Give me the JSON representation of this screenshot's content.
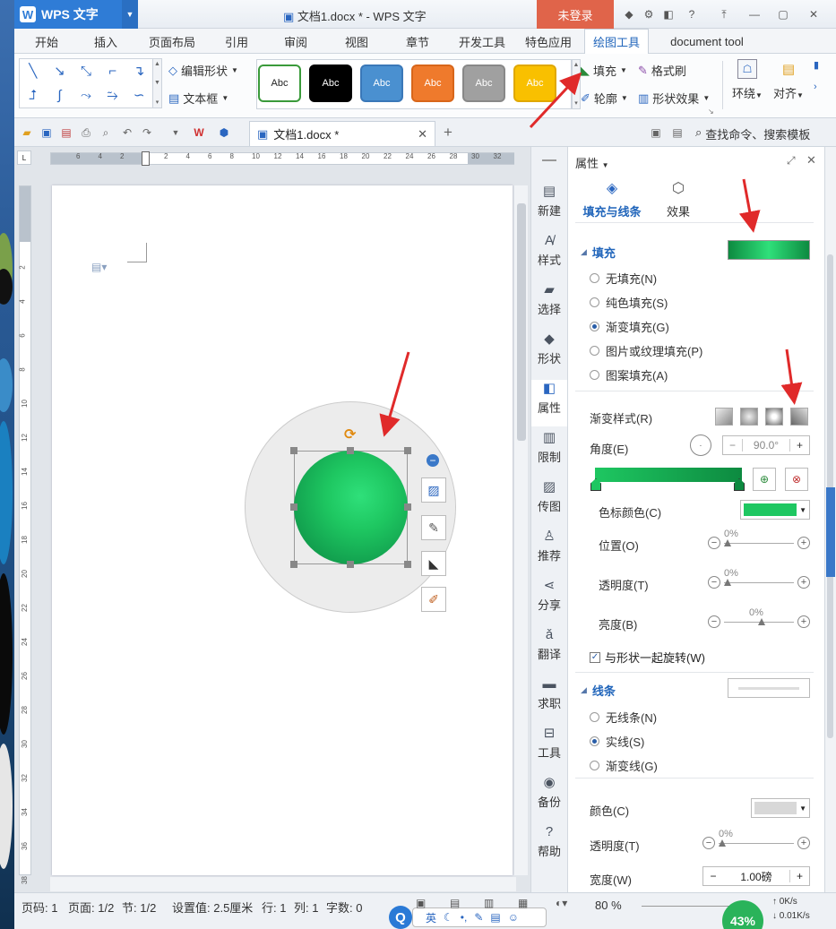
{
  "window": {
    "app_button": "WPS 文字",
    "title": "文档1.docx * - WPS 文字",
    "login_button": "未登录"
  },
  "menu_tabs": [
    {
      "label": "开始"
    },
    {
      "label": "插入"
    },
    {
      "label": "页面布局"
    },
    {
      "label": "引用"
    },
    {
      "label": "审阅"
    },
    {
      "label": "视图"
    },
    {
      "label": "章节"
    },
    {
      "label": "开发工具"
    },
    {
      "label": "特色应用"
    },
    {
      "label": "绘图工具",
      "active": true
    },
    {
      "label": "document tool"
    }
  ],
  "ribbon": {
    "edit_shape": "编辑形状",
    "text_box": "文本框",
    "fill": "填充",
    "format_painter": "格式刷",
    "outline": "轮廓",
    "shape_effects": "形状效果",
    "wrap": "环绕",
    "align": "对齐",
    "style_swatches": [
      {
        "label": "Abc",
        "bg": "#ffffff",
        "fg": "#222222",
        "border": "#3a9a3a"
      },
      {
        "label": "Abc",
        "bg": "#000000",
        "fg": "#ffffff",
        "border": "#000000"
      },
      {
        "label": "Abc",
        "bg": "#4a90d0",
        "fg": "#ffffff",
        "border": "#3a78b8"
      },
      {
        "label": "Abc",
        "bg": "#ef7a2c",
        "fg": "#ffffff",
        "border": "#d8661a"
      },
      {
        "label": "Abc",
        "bg": "#a0a0a0",
        "fg": "#ffffff",
        "border": "#888888"
      },
      {
        "label": "Abc",
        "bg": "#f9c000",
        "fg": "#ffffff",
        "border": "#e0a800"
      }
    ]
  },
  "quick_bar": {
    "doc_tab": "文档1.docx *",
    "search": "查找命令、搜索模板"
  },
  "ruler": {
    "h_ticks": [
      "6",
      "4",
      "2",
      "",
      "2",
      "4",
      "6",
      "8",
      "10",
      "12",
      "14",
      "16",
      "18",
      "20",
      "22",
      "24",
      "26",
      "28",
      "30",
      "32"
    ],
    "v_ticks": [
      "2",
      "4",
      "6",
      "8",
      "10",
      "12",
      "14",
      "16",
      "18",
      "20",
      "22",
      "24",
      "26",
      "28",
      "30",
      "32",
      "34",
      "36",
      "38"
    ]
  },
  "sidebar": [
    {
      "label": "新建",
      "icon": "new-doc-icon"
    },
    {
      "label": "样式",
      "icon": "style-icon"
    },
    {
      "label": "选择",
      "icon": "select-icon"
    },
    {
      "label": "形状",
      "icon": "shape-icon"
    },
    {
      "label": "属性",
      "icon": "property-icon",
      "active": true
    },
    {
      "label": "限制",
      "icon": "restrict-icon"
    },
    {
      "label": "传图",
      "icon": "image-upload-icon"
    },
    {
      "label": "推荐",
      "icon": "recommend-icon"
    },
    {
      "label": "分享",
      "icon": "share-icon"
    },
    {
      "label": "翻译",
      "icon": "translate-icon"
    },
    {
      "label": "求职",
      "icon": "job-icon"
    },
    {
      "label": "工具",
      "icon": "toolbox-icon"
    },
    {
      "label": "备份",
      "icon": "backup-icon"
    },
    {
      "label": "帮助",
      "icon": "help-icon"
    }
  ],
  "panel": {
    "title": "属性",
    "tabs": [
      {
        "label": "填充与线条",
        "active": true
      },
      {
        "label": "效果"
      }
    ],
    "fill": {
      "section": "填充",
      "options": [
        {
          "label": "无填充(N)",
          "checked": false
        },
        {
          "label": "纯色填充(S)",
          "checked": false
        },
        {
          "label": "渐变填充(G)",
          "checked": true
        },
        {
          "label": "图片或纹理填充(P)",
          "checked": false
        },
        {
          "label": "图案填充(A)",
          "checked": false
        }
      ],
      "gradient_style_label": "渐变样式(R)",
      "angle_label": "角度(E)",
      "angle_value": "90.0°",
      "stop_color_label": "色标颜色(C)",
      "stop_color": "#1ec761",
      "position_label": "位置(O)",
      "position_value": "0%",
      "transparency_label": "透明度(T)",
      "transparency_value": "0%",
      "brightness_label": "亮度(B)",
      "brightness_value": "0%",
      "rotate_label": "与形状一起旋转(W)",
      "rotate_checked": true
    },
    "line": {
      "section": "线条",
      "options": [
        {
          "label": "无线条(N)",
          "checked": false
        },
        {
          "label": "实线(S)",
          "checked": true
        },
        {
          "label": "渐变线(G)",
          "checked": false
        }
      ],
      "color_label": "颜色(C)",
      "transparency_label": "透明度(T)",
      "transparency_value": "0%",
      "width_label": "宽度(W)",
      "width_value": "1.00磅"
    }
  },
  "status": {
    "page_num": "页码: 1",
    "page": "页面: 1/2",
    "section": "节: 1/2",
    "setting": "设置值: 2.5厘米",
    "row": "行: 1",
    "col": "列: 1",
    "words": "字数: 0",
    "zoom": "80 %",
    "ime": "英",
    "battery": "43%",
    "net_up": "0K/s",
    "net_down": "0.01K/s"
  },
  "colors": {
    "accent": "#2f7cd6",
    "shape_green": "#1ec761",
    "arrow_red": "#e02a2a"
  }
}
